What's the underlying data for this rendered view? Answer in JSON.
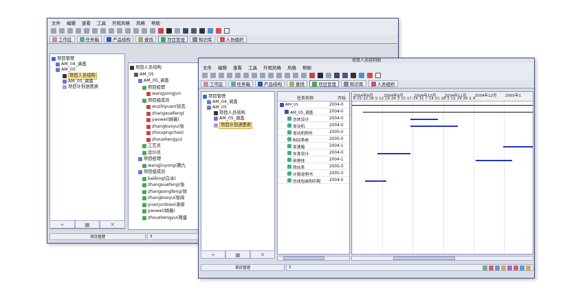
{
  "back_window": {
    "menu": [
      "文件",
      "编辑",
      "查看",
      "工具",
      "外观风格",
      "风格",
      "帮助"
    ],
    "tabs": [
      "工作区",
      "任务箱",
      "产品结构",
      "查找",
      "项目管理",
      "知识库",
      "人员组织"
    ],
    "active_tab": "项目管理",
    "left_tree": [
      {
        "label": "项目管理",
        "depth": 0
      },
      {
        "label": "AM_04_调盖",
        "depth": 1
      },
      {
        "label": "AM_05",
        "depth": 1
      },
      {
        "label": "项目人员结构",
        "depth": 2,
        "selected": true
      },
      {
        "label": "AM_05_调盖",
        "depth": 2
      },
      {
        "label": "项目计划进度表",
        "depth": 2
      }
    ],
    "right_tree": [
      {
        "label": "项目人员结构",
        "depth": 0
      },
      {
        "label": "AM_05",
        "depth": 1
      },
      {
        "label": "AM_05_调盖",
        "depth": 2
      },
      {
        "label": "项目经理",
        "depth": 3
      },
      {
        "label": "wangyongjun",
        "depth": 4
      },
      {
        "label": "项目组成员",
        "depth": 3
      },
      {
        "label": "wuzhiyuan(徐志",
        "depth": 4
      },
      {
        "label": "zhangxuefeng(",
        "depth": 4
      },
      {
        "label": "yaowei(姚薇)",
        "depth": 4
      },
      {
        "label": "zhangkuoyu(张",
        "depth": 4
      },
      {
        "label": "zhouqingchao(",
        "depth": 4
      },
      {
        "label": "zhoushengyu(",
        "depth": 4
      },
      {
        "label": "工艺员",
        "depth": 3
      },
      {
        "label": "设计员",
        "depth": 3
      },
      {
        "label": "项目经理",
        "depth": 2
      },
      {
        "label": "wangjiuyong(魏九",
        "depth": 3
      },
      {
        "label": "项目组成员",
        "depth": 2
      },
      {
        "label": "baibing(白冰)",
        "depth": 3
      },
      {
        "label": "zhangxuefeng(张",
        "depth": 3
      },
      {
        "label": "zhangsongfeng(张",
        "depth": 3
      },
      {
        "label": "zhangkuoyu(张阔",
        "depth": 3
      },
      {
        "label": "yuanjunbiao(袁俊",
        "depth": 3
      },
      {
        "label": "yaowei(姚薇)",
        "depth": 3
      },
      {
        "label": "zhoushengyu(周盛",
        "depth": 3
      }
    ],
    "status_left": "项目管理",
    "status_right": "3"
  },
  "front_window": {
    "title": "项目人员结构图",
    "menu": [
      "文件",
      "编辑",
      "查看",
      "工具",
      "外观风格",
      "风格",
      "帮助"
    ],
    "tabs": [
      "工作区",
      "任务箱",
      "产品结构",
      "查找",
      "项目管理",
      "知识库",
      "人员组织"
    ],
    "active_tab": "项目管理",
    "left_tree": [
      {
        "label": "项目管理",
        "depth": 0
      },
      {
        "label": "AM_04_调盖",
        "depth": 1
      },
      {
        "label": "AM_05",
        "depth": 1
      },
      {
        "label": "项目人员结构",
        "depth": 2
      },
      {
        "label": "AM_05_调盖",
        "depth": 2
      },
      {
        "label": "项目计划进度表",
        "depth": 2,
        "selected": true
      }
    ],
    "grid_header": {
      "task_name": "任务名称",
      "start": "开始"
    },
    "months": [
      "2004年8月",
      "2004年9月",
      "2004年10月",
      "2004年11月",
      "2004年12月",
      "2005年1"
    ],
    "days_label": "8  15 22 29 5  12 19 26 3  10 17 24 31 7  14 21 28 5  12 19 26 2  9",
    "tasks": [
      {
        "name": "AM_05",
        "start": "2004-0",
        "bar_from": 0.0,
        "bar_to": 1.0,
        "summary": true
      },
      {
        "name": "AM_05_调盖",
        "start": "2004-0",
        "bar_from": 0.06,
        "bar_to": 1.0,
        "summary": true
      },
      {
        "name": "总体设计",
        "start": "2004-0",
        "bar_from": 0.32,
        "bar_to": 0.47
      },
      {
        "name": "发动机",
        "start": "2004-0",
        "bar_from": 0.32,
        "bar_to": 0.58
      },
      {
        "name": "发动机附件",
        "start": "2005-0",
        "bar_from": 0.0,
        "bar_to": 0.0
      },
      {
        "name": "制动系统",
        "start": "2005-0",
        "bar_from": 0.0,
        "bar_to": 0.0
      },
      {
        "name": "变速箱",
        "start": "2004-1",
        "bar_from": 0.83,
        "bar_to": 1.0
      },
      {
        "name": "车身设计",
        "start": "2004-0",
        "bar_from": 0.14,
        "bar_to": 0.32
      },
      {
        "name": "前悬挂",
        "start": "2004-1",
        "bar_from": 0.68,
        "bar_to": 0.88
      },
      {
        "name": "转向系",
        "start": "2005-0",
        "bar_from": 0.0,
        "bar_to": 0.0
      },
      {
        "name": "计算说明书",
        "start": "2005-0",
        "bar_from": 0.0,
        "bar_to": 0.0
      },
      {
        "name": "总成包装和匹配",
        "start": "2004-0",
        "bar_from": 0.07,
        "bar_to": 0.19
      }
    ],
    "status_left": "项目管理",
    "status_right": "3"
  },
  "colors": {
    "selection": "#fbe7a0",
    "gantt_bar": "#2530c8",
    "window_border": "#3a4a7a"
  }
}
